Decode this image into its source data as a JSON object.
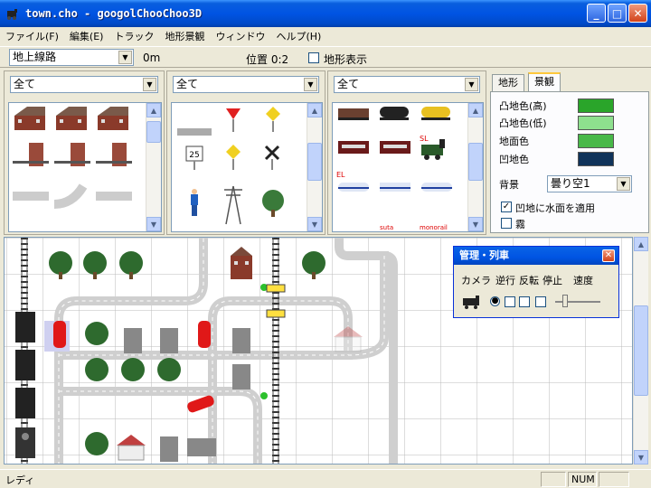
{
  "window": {
    "title": "town.cho - googolChooChoo3D"
  },
  "menu": [
    "ファイル(F)",
    "編集(E)",
    "トラック",
    "地形景観",
    "ウィンドウ",
    "ヘルプ(H)"
  ],
  "toolbar": {
    "track_type": "地上線路",
    "height": "0m",
    "position_label": "位置 0:2",
    "terrain_display_label": "地形表示"
  },
  "palettes": {
    "filter_all_1": "全て",
    "filter_all_2": "全て",
    "filter_all_3": "全て",
    "sign_number": "25",
    "train_labels": {
      "sl": "SL",
      "el": "EL",
      "suta": "suta",
      "monorail": "monorail"
    }
  },
  "settings": {
    "tabs": [
      "地形",
      "景観"
    ],
    "active_tab": "景観",
    "colors": [
      {
        "label": "凸地色(高)",
        "color": "#2aa52a"
      },
      {
        "label": "凸地色(低)",
        "color": "#8ee08e"
      },
      {
        "label": "地面色",
        "color": "#48b848"
      },
      {
        "label": "凹地色",
        "color": "#10335a"
      }
    ],
    "background_label": "背景",
    "background_value": "曇り空1",
    "water_label": "凹地に水面を適用",
    "water_checked": true,
    "fog_label": "霧",
    "fog_checked": false
  },
  "train_control": {
    "title": "管理・列車",
    "headers": {
      "camera": "カメラ",
      "direction": "逆行",
      "reverse": "反転",
      "stop": "停止",
      "speed": "速度"
    }
  },
  "status": {
    "text": "レディ",
    "num": "NUM"
  }
}
